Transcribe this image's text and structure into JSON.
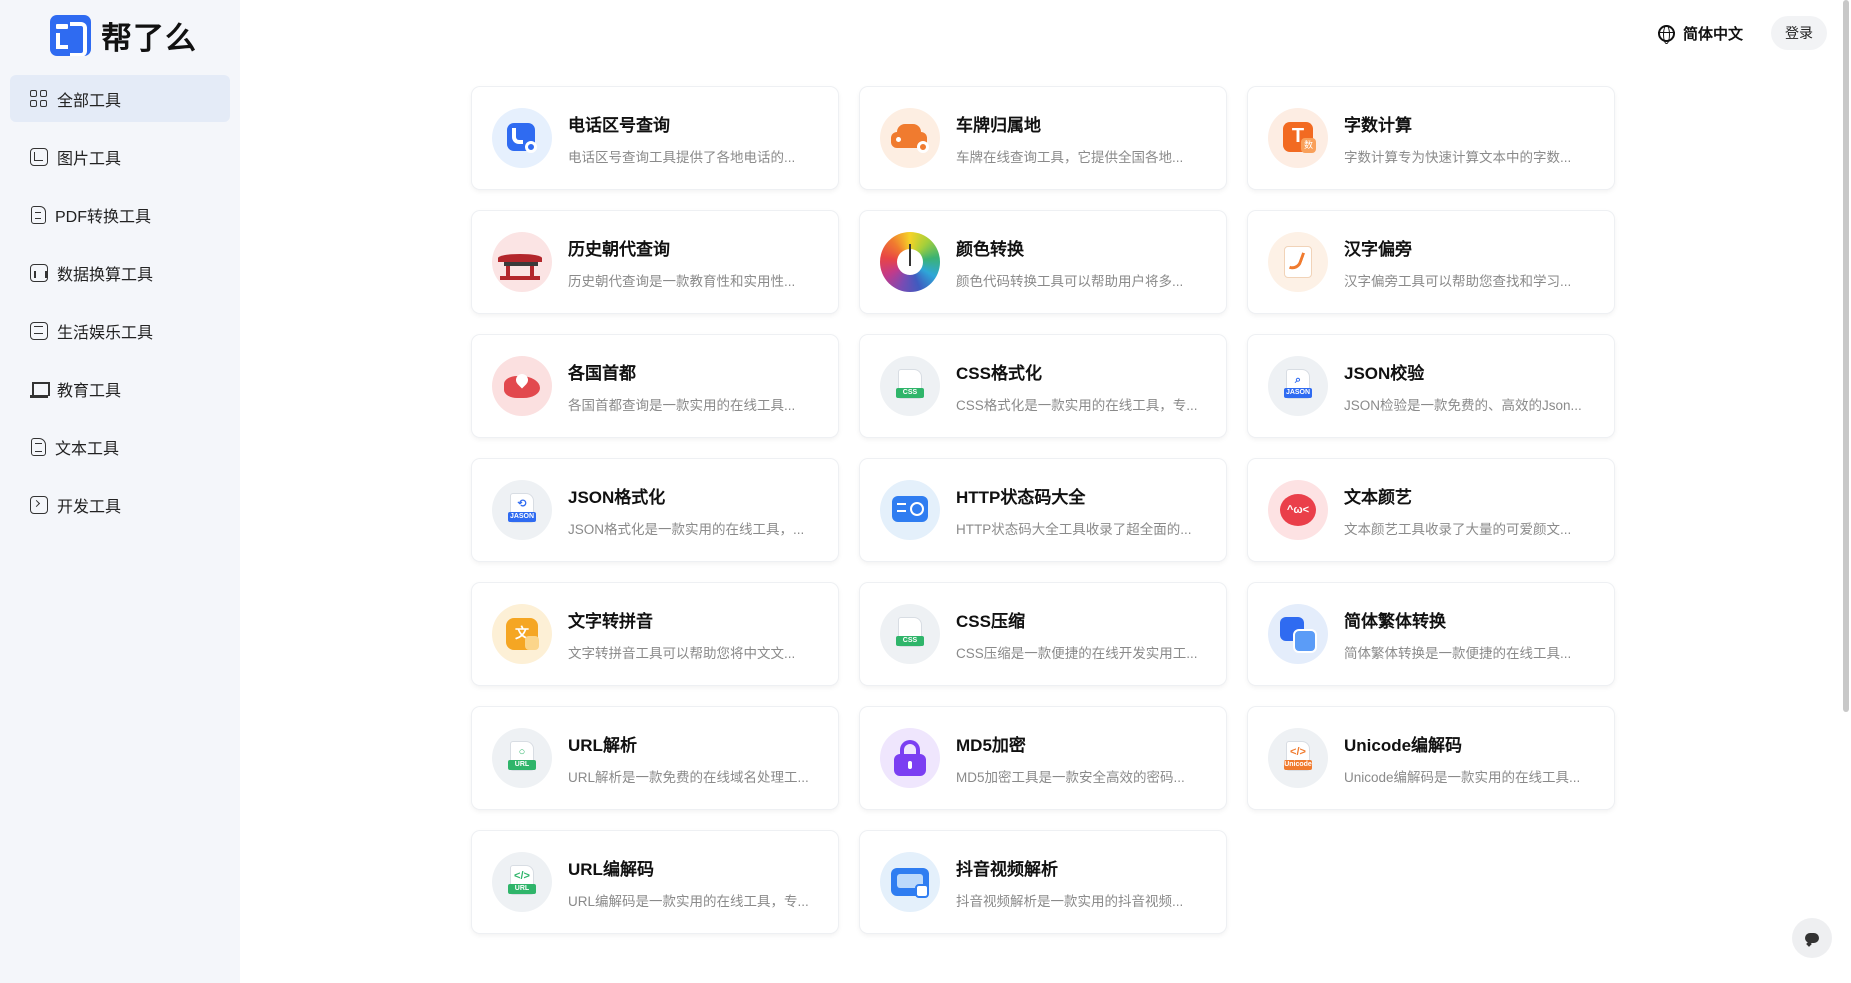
{
  "app": {
    "name": "帮了么"
  },
  "header": {
    "language": "简体中文",
    "login": "登录"
  },
  "sidebar": {
    "items": [
      {
        "label": "全部工具",
        "icon": "grid-icon",
        "active": true
      },
      {
        "label": "图片工具",
        "icon": "image-icon",
        "active": false
      },
      {
        "label": "PDF转换工具",
        "icon": "pdf-icon",
        "active": false
      },
      {
        "label": "数据换算工具",
        "icon": "chart-icon",
        "active": false
      },
      {
        "label": "生活娱乐工具",
        "icon": "entertainment-icon",
        "active": false
      },
      {
        "label": "教育工具",
        "icon": "education-icon",
        "active": false
      },
      {
        "label": "文本工具",
        "icon": "text-icon",
        "active": false
      },
      {
        "label": "开发工具",
        "icon": "terminal-icon",
        "active": false
      }
    ]
  },
  "tools": [
    {
      "title": "电话区号查询",
      "desc": "电话区号查询工具提供了各地电话的...",
      "icon": "phone-search-icon",
      "color": "#2f6bf1",
      "bg": "#e6f0fd"
    },
    {
      "title": "车牌归属地",
      "desc": "车牌在线查询工具，它提供全国各地...",
      "icon": "car-search-icon",
      "color": "#f07b2f",
      "bg": "#fdeee2"
    },
    {
      "title": "字数计算",
      "desc": "字数计算专为快速计算文本中的字数...",
      "icon": "word-count-icon",
      "color": "#f26a21",
      "bg": "#fdede3"
    },
    {
      "title": "历史朝代查询",
      "desc": "历史朝代查询是一款教育性和实用性...",
      "icon": "pavilion-icon",
      "color": "#b3262b",
      "bg": "#fbe4e4"
    },
    {
      "title": "颜色转换",
      "desc": "颜色代码转换工具可以帮助用户将多...",
      "icon": "color-wheel-icon",
      "color": "#e84545",
      "bg": "#ffffff"
    },
    {
      "title": "汉字偏旁",
      "desc": "汉字偏旁工具可以帮助您查找和学习...",
      "icon": "radical-icon",
      "color": "#f07b2f",
      "bg": "#fdf1e6"
    },
    {
      "title": "各国首都",
      "desc": "各国首都查询是一款实用的在线工具...",
      "icon": "map-pin-icon",
      "color": "#e2494e",
      "bg": "#fbe0e0"
    },
    {
      "title": "CSS格式化",
      "desc": "CSS格式化是一款实用的在线工具，专...",
      "icon": "css-file-icon",
      "color": "#2fb56a",
      "bg": "#eef1f4"
    },
    {
      "title": "JSON校验",
      "desc": "JSON检验是一款免费的、高效的Json...",
      "icon": "json-search-icon",
      "color": "#2f6bf1",
      "bg": "#eef1f4"
    },
    {
      "title": "JSON格式化",
      "desc": "JSON格式化是一款实用的在线工具，...",
      "icon": "json-format-icon",
      "color": "#2f6bf1",
      "bg": "#eef1f4"
    },
    {
      "title": "HTTP状态码大全",
      "desc": "HTTP状态码大全工具收录了超全面的...",
      "icon": "http-globe-icon",
      "color": "#2f7df1",
      "bg": "#e4f0fb"
    },
    {
      "title": "文本颜艺",
      "desc": "文本颜艺工具收录了大量的可爱颜文...",
      "icon": "emoticon-icon",
      "color": "#ea3f4a",
      "bg": "#fde2e3"
    },
    {
      "title": "文字转拼音",
      "desc": "文字转拼音工具可以帮助您将中文文...",
      "icon": "pinyin-icon",
      "color": "#f5a623",
      "bg": "#fdf0d6"
    },
    {
      "title": "CSS压缩",
      "desc": "CSS压缩是一款便捷的在线开发实用工...",
      "icon": "css-compress-icon",
      "color": "#2fb56a",
      "bg": "#eef1f4"
    },
    {
      "title": "简体繁体转换",
      "desc": "简体繁体转换是一款便捷的在线工具...",
      "icon": "convert-icon",
      "color": "#2f6bf1",
      "bg": "#e4edfb"
    },
    {
      "title": "URL解析",
      "desc": "URL解析是一款免费的在线域名处理工...",
      "icon": "url-parse-icon",
      "color": "#2fb56a",
      "bg": "#eef1f4"
    },
    {
      "title": "MD5加密",
      "desc": "MD5加密工具是一款安全高效的密码...",
      "icon": "lock-icon",
      "color": "#7b3ff2",
      "bg": "#efe6fd"
    },
    {
      "title": "Unicode编解码",
      "desc": "Unicode编解码是一款实用的在线工具...",
      "icon": "unicode-file-icon",
      "color": "#f07b2f",
      "bg": "#eef1f4"
    },
    {
      "title": "URL编解码",
      "desc": "URL编解码是一款实用的在线工具，专...",
      "icon": "url-code-icon",
      "color": "#2fb56a",
      "bg": "#eef1f4"
    },
    {
      "title": "抖音视频解析",
      "desc": "抖音视频解析是一款实用的抖音视频...",
      "icon": "video-parse-icon",
      "color": "#2f7df1",
      "bg": "#e4f0fb"
    }
  ],
  "icon_badges": {
    "word_count": "T",
    "word_count_sub": "数",
    "css": "CSS",
    "json": "JASON",
    "url": "URL",
    "unicode": "Unicode",
    "emoticon": "^ω<"
  }
}
